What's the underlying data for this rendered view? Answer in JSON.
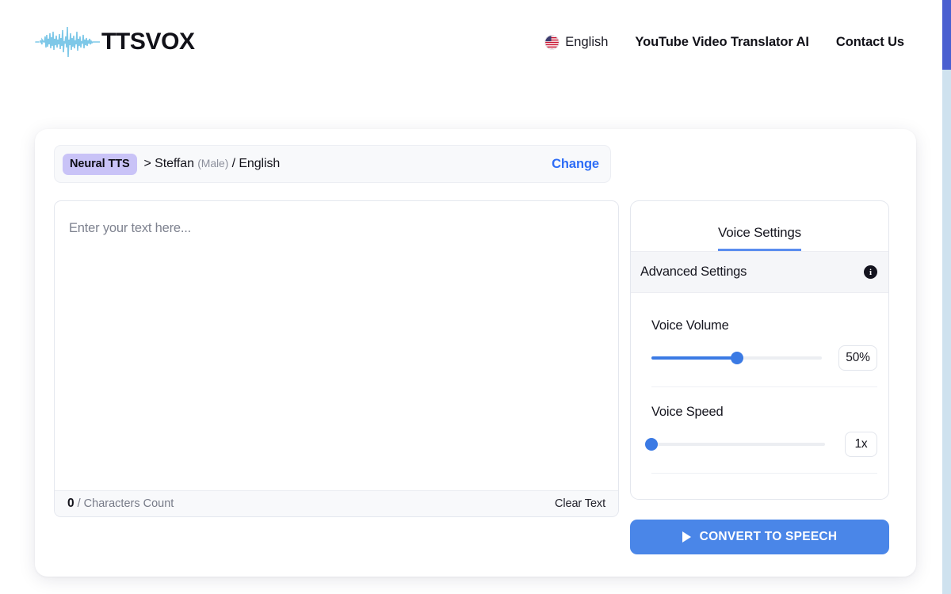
{
  "header": {
    "logo_text": "TTSVOX",
    "logo_icon": "waveform-icon",
    "nav": {
      "language_label": "English",
      "language_flag_icon": "us-flag-icon",
      "links": [
        {
          "label": "YouTube Video Translator AI"
        },
        {
          "label": "Contact Us"
        }
      ]
    }
  },
  "voice_bar": {
    "badge": "Neural TTS",
    "separator": ">",
    "voice_name": "Steffan",
    "gender": "(Male)",
    "language": "/ English",
    "change_label": "Change"
  },
  "editor": {
    "placeholder": "Enter your text here...",
    "value": "",
    "char_count": "0",
    "char_count_label": "/ Characters Count",
    "clear_label": "Clear Text"
  },
  "settings": {
    "tab_label": "Voice Settings",
    "advanced_label": "Advanced Settings",
    "info_icon": "info-icon",
    "info_glyph": "i",
    "volume": {
      "label": "Voice Volume",
      "value_text": "50%",
      "percent": 50
    },
    "speed": {
      "label": "Voice Speed",
      "value_text": "1x",
      "percent": 0
    }
  },
  "convert_button": {
    "label": "CONVERT TO SPEECH",
    "icon": "play-icon"
  },
  "colors": {
    "accent_blue": "#4a86e8",
    "link_blue": "#2e6df6",
    "badge_purple": "#c9c3f7",
    "slider_blue": "#3b7ae4",
    "tab_underline": "#5b8def",
    "scrollbar_thumb": "#4a5fd0"
  }
}
